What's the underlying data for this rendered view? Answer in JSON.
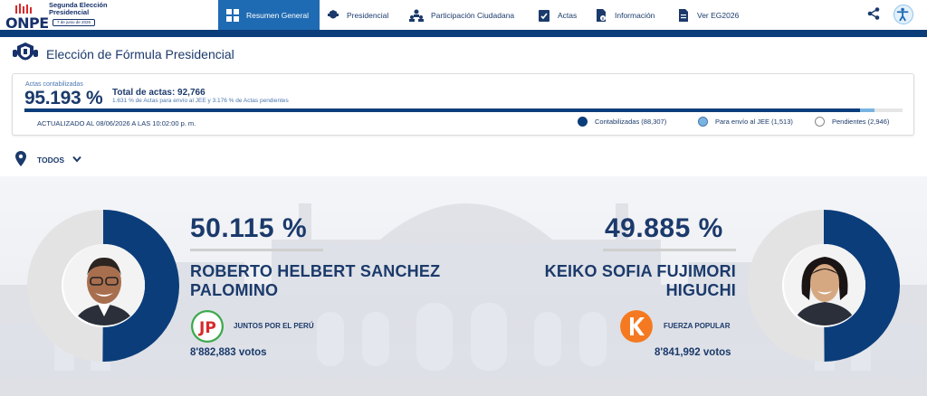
{
  "brand": {
    "logo_word": "ONPE",
    "title_line1": "Segunda Elección",
    "title_line2": "Presidencial",
    "date": "7 de junio de 2026"
  },
  "nav": {
    "items": [
      {
        "label": "Resumen General",
        "icon": "grid-icon",
        "active": true
      },
      {
        "label": "Presidencial",
        "icon": "seal-icon"
      },
      {
        "label": "Participación Ciudadana",
        "icon": "people-icon"
      },
      {
        "label": "Actas",
        "icon": "clipboard-check-icon"
      },
      {
        "label": "Información",
        "icon": "document-info-icon"
      },
      {
        "label": "Ver EG2026",
        "icon": "document-icon"
      }
    ],
    "share_icon": "share-icon",
    "accessibility_icon": "accessibility-icon"
  },
  "page": {
    "title": "Elección de Fórmula Presidencial"
  },
  "summary": {
    "acts_label": "Actas contabilizadas",
    "acts_percent": "95.193 %",
    "acts_percent_value": 95.193,
    "jee_percent_value": 1.631,
    "total_label": "Total de actas: 92,766",
    "sub_text": "1.631 % de Actas para envío al JEE y 3.176 % de Actas pendientes",
    "updated": "ACTUALIZADO AL 08/06/2026 A LAS 10:02:00 p. m.",
    "legend": [
      {
        "label": "Contabilizadas (88,307)",
        "color": "#0b3d7a"
      },
      {
        "label": "Para envío al JEE (1,513)",
        "color": "#79b4e0"
      },
      {
        "label": "Pendientes (2,946)",
        "color": "#ffffff"
      }
    ]
  },
  "filter": {
    "label": "TODOS"
  },
  "candidates": [
    {
      "percent": "50.115 %",
      "percent_value": 50.115,
      "name_line1": "ROBERTO HELBERT SANCHEZ",
      "name_line2": "PALOMINO",
      "party": "JUNTOS POR EL PERÚ",
      "votes": "8'882,883 votos",
      "color": "#0b3d7a"
    },
    {
      "percent": "49.885 %",
      "percent_value": 49.885,
      "name_line1": "KEIKO SOFIA FUJIMORI",
      "name_line2": "HIGUCHI",
      "party": "FUERZA POPULAR",
      "votes": "8'841,992 votos",
      "color": "#0b3d7a"
    }
  ]
}
